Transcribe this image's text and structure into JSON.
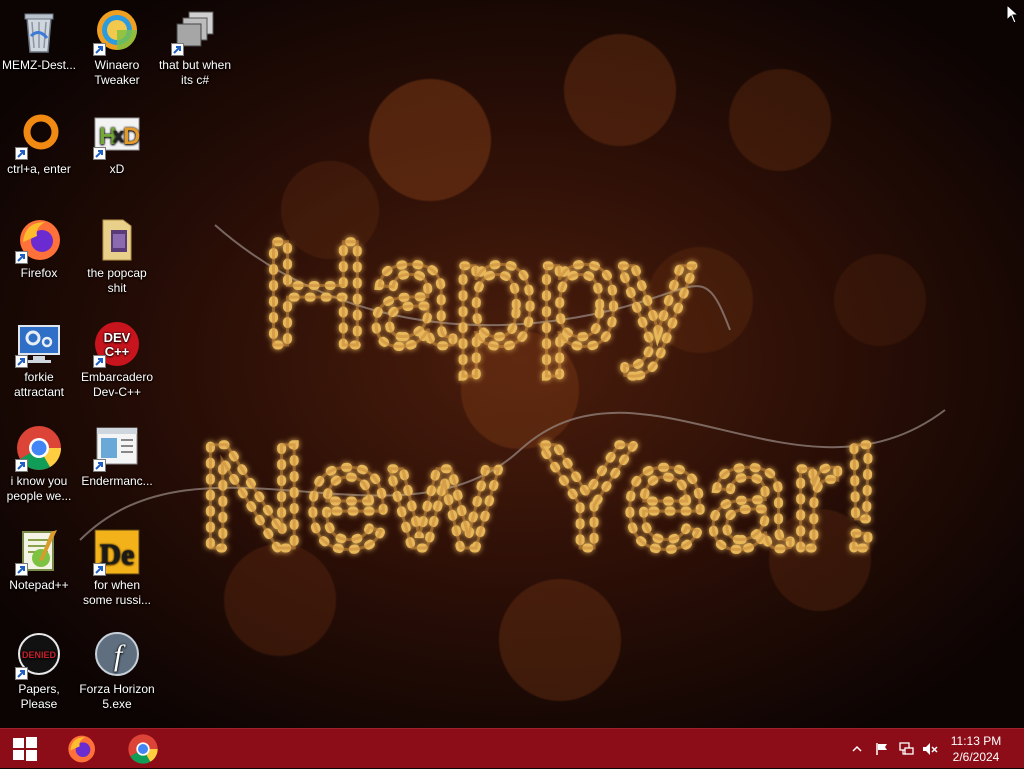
{
  "wallpaper": {
    "line1": "Happy",
    "line2": "New Year!"
  },
  "desktop_icons": [
    {
      "label": "MEMZ-Dest...",
      "icon": "recycle-bin-icon"
    },
    {
      "label": "Winaero Tweaker",
      "icon": "winaero-tweaker-icon"
    },
    {
      "label": "that but when its c#",
      "icon": "stacked-windows-icon"
    },
    {
      "label": "ctrl+a, enter",
      "icon": "orange-ring-icon"
    },
    {
      "label": "xD",
      "icon": "hxd-hex-editor-icon"
    },
    {
      "label": "Firefox",
      "icon": "firefox-icon"
    },
    {
      "label": "the popcap shit",
      "icon": "folder-icon"
    },
    {
      "label": "forkie attractant",
      "icon": "monitor-settings-icon"
    },
    {
      "label": "Embarcadero Dev-C++",
      "icon": "dev-cpp-icon"
    },
    {
      "label": "i know you people we...",
      "icon": "chrome-icon"
    },
    {
      "label": "Endermanc...",
      "icon": "window-app-icon"
    },
    {
      "label": "Notepad++",
      "icon": "notepad-plus-plus-icon"
    },
    {
      "label": "for when some russi...",
      "icon": "de-app-icon"
    },
    {
      "label": "Papers, Please",
      "icon": "papers-please-icon"
    },
    {
      "label": "Forza Horizon 5.exe",
      "icon": "flash-player-icon"
    }
  ],
  "taskbar": {
    "start": "windows-start-icon",
    "pinned": [
      "firefox-icon",
      "chrome-icon"
    ],
    "tray": [
      "show-hidden-icons-chevron",
      "action-center-flag-icon",
      "network-icon",
      "volume-muted-icon"
    ],
    "clock_time": "11:13 PM",
    "clock_date": "2/6/2024",
    "color": "#8c0d17"
  }
}
